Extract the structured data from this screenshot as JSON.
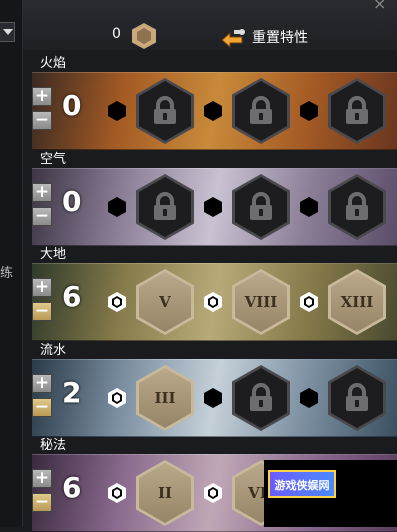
{
  "header": {
    "points": "0",
    "reset_label": "重置特性",
    "side_char": "练"
  },
  "lines": [
    {
      "name": "火焰",
      "rank": "0",
      "majors": [
        {
          "locked": true,
          "numeral": ""
        },
        {
          "locked": true,
          "numeral": ""
        },
        {
          "locked": true,
          "numeral": ""
        }
      ],
      "minors_on": [
        false,
        false,
        false
      ],
      "colors": [
        "#3a2a22",
        "#a45a24",
        "#c88a3a",
        "#6a3620"
      ]
    },
    {
      "name": "空气",
      "rank": "0",
      "majors": [
        {
          "locked": true,
          "numeral": ""
        },
        {
          "locked": true,
          "numeral": ""
        },
        {
          "locked": true,
          "numeral": ""
        }
      ],
      "minors_on": [
        false,
        false,
        false
      ],
      "colors": [
        "#3d3545",
        "#8a7e96",
        "#c9c2d2",
        "#5a4d6a"
      ]
    },
    {
      "name": "大地",
      "rank": "6",
      "majors": [
        {
          "locked": false,
          "numeral": "V"
        },
        {
          "locked": false,
          "numeral": "VIII"
        },
        {
          "locked": false,
          "numeral": "XIII"
        }
      ],
      "minors_on": [
        true,
        true,
        true
      ],
      "colors": [
        "#2f3a2a",
        "#857a4a",
        "#b7aa78",
        "#4a4a30"
      ]
    },
    {
      "name": "流水",
      "rank": "2",
      "majors": [
        {
          "locked": false,
          "numeral": "III"
        },
        {
          "locked": true,
          "numeral": ""
        },
        {
          "locked": true,
          "numeral": ""
        }
      ],
      "minors_on": [
        true,
        false,
        false
      ],
      "colors": [
        "#2a3a48",
        "#7a8ea0",
        "#c5d0d8",
        "#3a5060"
      ]
    },
    {
      "name": "秘法",
      "rank": "6",
      "majors": [
        {
          "locked": false,
          "numeral": "II"
        },
        {
          "locked": false,
          "numeral": "VII"
        },
        {
          "locked": false,
          "numeral": ""
        }
      ],
      "minors_on": [
        true,
        true,
        true
      ],
      "colors": [
        "#3a2a3e",
        "#8a6a8e",
        "#c0a7b5",
        "#5a3c5e"
      ]
    }
  ],
  "watermark": {
    "text": "游戏侠娱网"
  }
}
